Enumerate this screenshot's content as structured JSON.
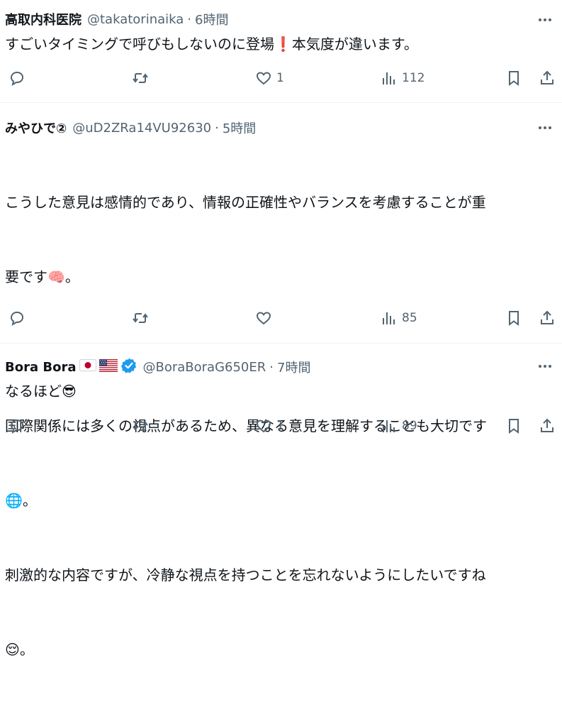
{
  "tweets": [
    {
      "name": "高取内科医院",
      "handle": "@takatorinaika",
      "dot": "·",
      "time": "6時間",
      "text": "すごいタイミングで呼びもしないのに登場❗本気度が違います。",
      "stats": {
        "reply": "",
        "retweet": "",
        "like": "1",
        "views": "112"
      }
    },
    {
      "name": "みやひで②",
      "handle": "@uD2ZRa14VU92630",
      "dot": "·",
      "time": "5時間",
      "text_lines": [
        "こうした意見は感情的であり、情報の正確性やバランスを考慮することが重",
        "要です🧠。",
        "",
        "国際関係には多くの視点があるため、異なる意見を理解することも大切です",
        "🌐。",
        "刺激的な内容ですが、冷静な視点を持つことを忘れないようにしたいですね",
        "😌。"
      ],
      "stats": {
        "reply": "",
        "retweet": "",
        "like": "",
        "views": "85"
      }
    },
    {
      "name": "Bora Bora",
      "flags": [
        "japan-flag",
        "usa-flag"
      ],
      "verified": true,
      "handle": "@BoraBoraG650ER",
      "dot": "·",
      "time": "7時間",
      "text": "なるほど😎",
      "stats": {
        "reply": "",
        "retweet": "",
        "like": "1",
        "views": "89"
      }
    }
  ],
  "colors": {
    "text": "#0f1419",
    "muted": "#536471",
    "border": "#eff3f4",
    "verified": "#1d9bf0",
    "emphasis": "#e0245e"
  }
}
